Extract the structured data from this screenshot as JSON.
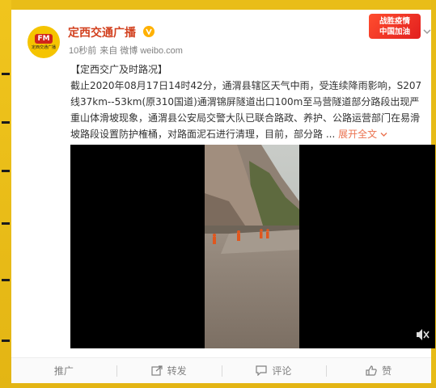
{
  "post": {
    "avatar": {
      "fm": "FM",
      "station": "定西交通广播"
    },
    "username": "定西交通广播",
    "time": "10秒前",
    "source": "来自 微博 weibo.com",
    "badge": {
      "line1": "战胜疫情",
      "line2": "中国加油"
    },
    "text_title": "【定西交广及时路况】",
    "text_body": "截止2020年08月17日14时42分，通渭县辖区天气中雨，受连续降雨影响，S207线37km--53km(原310国道)通渭锦屏隧道出口100m至马营隧道部分路段出现严重山体滑坡现象，通渭县公安局交警大队已联合路政、养护、公路运营部门在易滑坡路段设置防护榷桶，对路面泥石进行清理，目前，部分路 ...",
    "expand_label": "展开全文",
    "expand_icon": "chevron-down-icon"
  },
  "actions": [
    {
      "label": "推广",
      "icon": ""
    },
    {
      "label": "转发",
      "icon": "share-icon"
    },
    {
      "label": "评论",
      "icon": "comment-icon"
    },
    {
      "label": "赞",
      "icon": "thumbs-up-icon"
    }
  ],
  "colors": {
    "username": "#d2401e",
    "link": "#eb7350",
    "badge": "#e21f1f",
    "poster_yellow": "#ecc41c"
  }
}
